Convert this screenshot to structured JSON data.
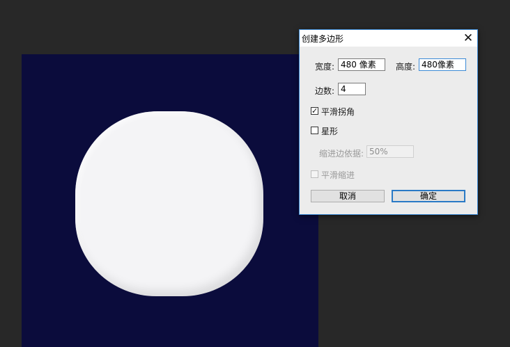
{
  "dialog": {
    "title": "创建多边形",
    "close_glyph": "✕",
    "width_label": "宽度:",
    "width_value": "480 像素",
    "height_label": "高度:",
    "height_value": "480像素",
    "sides_label": "边数:",
    "sides_value": "4",
    "smooth_corners": {
      "label": "平滑拐角",
      "checked": true,
      "glyph": "✓"
    },
    "star": {
      "label": "星形",
      "checked": false
    },
    "indent_label": "缩进边依据:",
    "indent_value": "50%",
    "smooth_indents": {
      "label": "平滑缩进",
      "checked": false
    },
    "cancel_label": "取消",
    "ok_label": "确定"
  },
  "colors": {
    "app_background": "#282828",
    "canvas": "#0b0c3c",
    "shape_fill": "#f4f4f6",
    "accent": "#3c8ad6"
  }
}
